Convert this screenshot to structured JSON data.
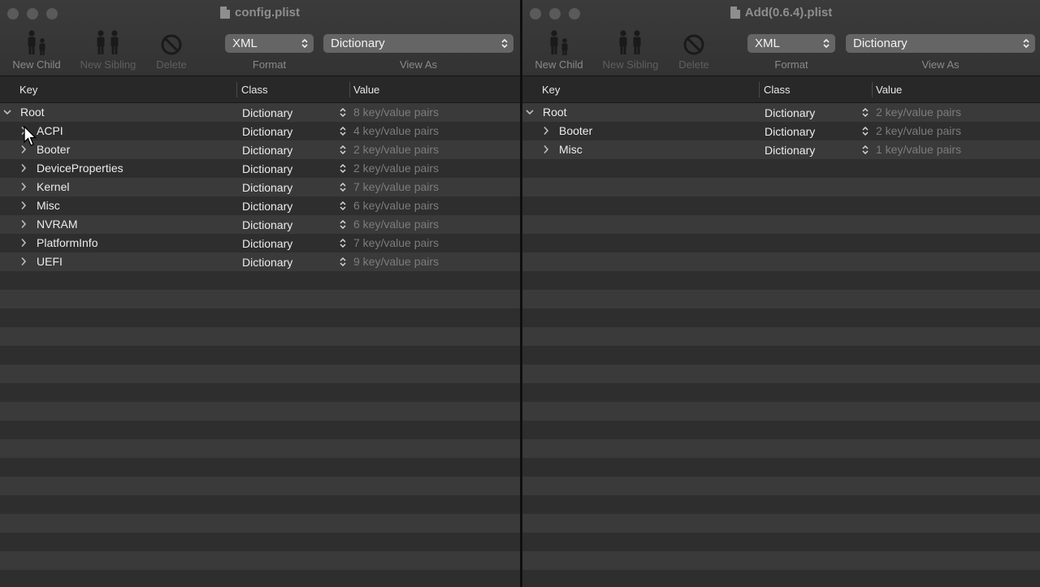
{
  "left": {
    "title": "config.plist",
    "toolbar": {
      "new_child": "New Child",
      "new_sibling": "New Sibling",
      "delete": "Delete",
      "format_value": "XML",
      "format_label": "Format",
      "view_as_value": "Dictionary",
      "view_as_label": "View As"
    },
    "columns": {
      "key": "Key",
      "class": "Class",
      "value": "Value"
    },
    "rows": [
      {
        "key": "Root",
        "class": "Dictionary",
        "value": "8 key/value pairs"
      },
      {
        "key": "ACPI",
        "class": "Dictionary",
        "value": "4 key/value pairs"
      },
      {
        "key": "Booter",
        "class": "Dictionary",
        "value": "2 key/value pairs"
      },
      {
        "key": "DeviceProperties",
        "class": "Dictionary",
        "value": "2 key/value pairs"
      },
      {
        "key": "Kernel",
        "class": "Dictionary",
        "value": "7 key/value pairs"
      },
      {
        "key": "Misc",
        "class": "Dictionary",
        "value": "6 key/value pairs"
      },
      {
        "key": "NVRAM",
        "class": "Dictionary",
        "value": "6 key/value pairs"
      },
      {
        "key": "PlatformInfo",
        "class": "Dictionary",
        "value": "7 key/value pairs"
      },
      {
        "key": "UEFI",
        "class": "Dictionary",
        "value": "9 key/value pairs"
      }
    ]
  },
  "right": {
    "title": "Add(0.6.4).plist",
    "toolbar": {
      "new_child": "New Child",
      "new_sibling": "New Sibling",
      "delete": "Delete",
      "format_value": "XML",
      "format_label": "Format",
      "view_as_value": "Dictionary",
      "view_as_label": "View As"
    },
    "columns": {
      "key": "Key",
      "class": "Class",
      "value": "Value"
    },
    "rows": [
      {
        "key": "Root",
        "class": "Dictionary",
        "value": "2 key/value pairs"
      },
      {
        "key": "Booter",
        "class": "Dictionary",
        "value": "2 key/value pairs"
      },
      {
        "key": "Misc",
        "class": "Dictionary",
        "value": "1 key/value pairs"
      }
    ]
  },
  "colors": {
    "window_bg": "#2b2b2b",
    "row_odd": "#3a3a3a",
    "row_even": "#2e2e2e",
    "popup": "#656565",
    "muted_text": "#7c7c7c"
  },
  "icons": [
    "close-button",
    "minimize-button",
    "zoom-button",
    "document-icon",
    "new-child-icon",
    "new-sibling-icon",
    "delete-icon",
    "chevron-updown-icon",
    "disclosure-down-icon",
    "disclosure-right-icon",
    "mouse-pointer-icon"
  ]
}
